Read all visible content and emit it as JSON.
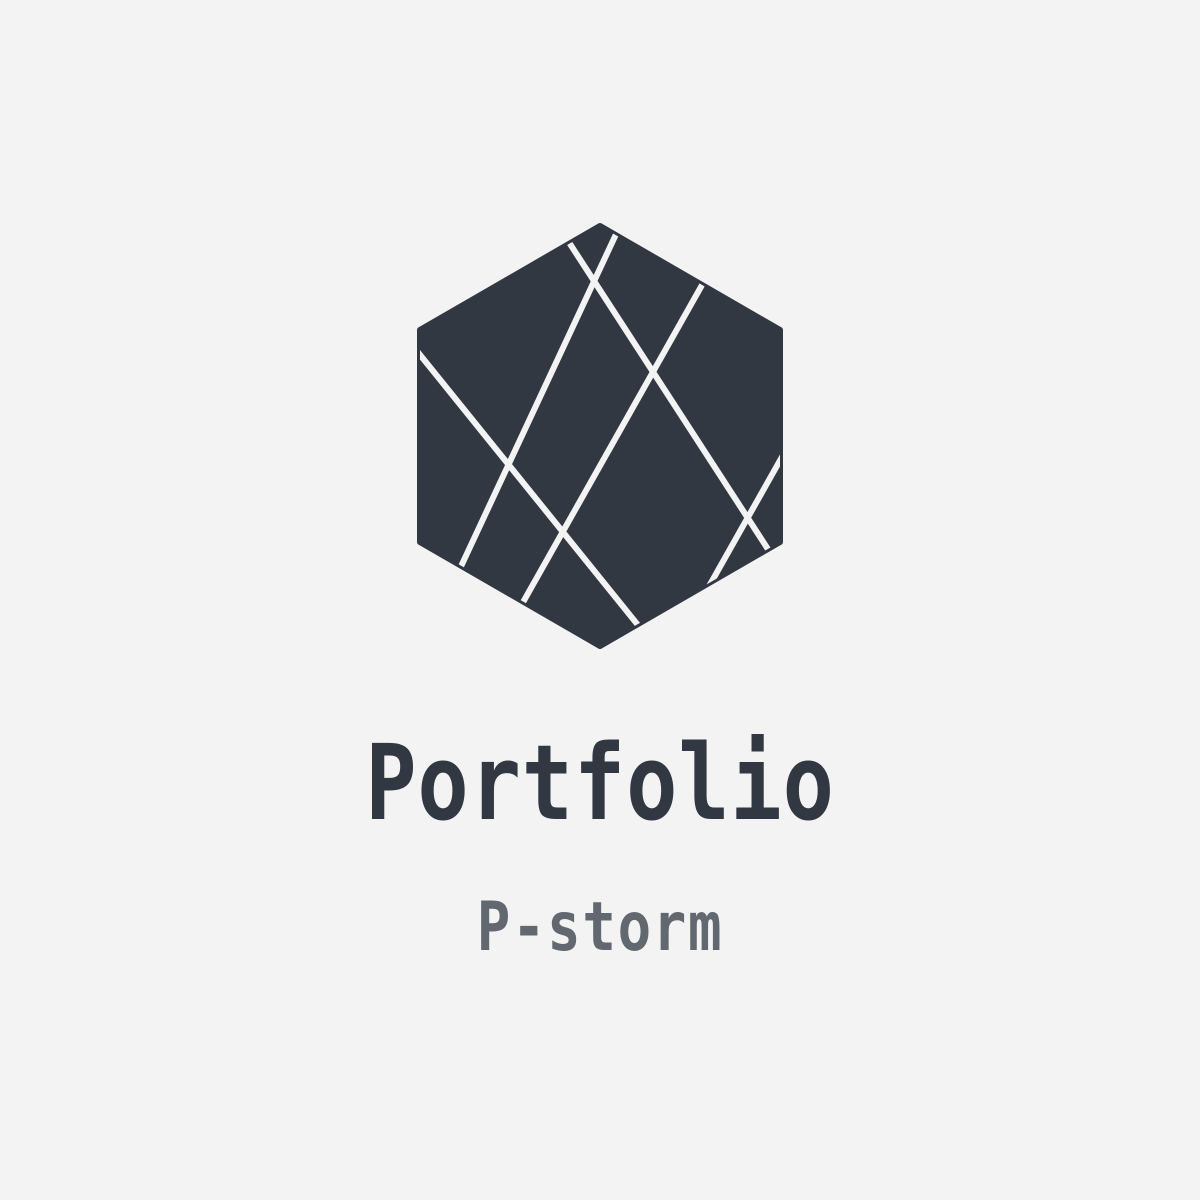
{
  "colors": {
    "background": "#f3f3f3",
    "mark": "#313842",
    "title": "#313842",
    "subtitle": "#626870",
    "facet_line": "#f3f3f3"
  },
  "logo": {
    "icon": "faceted-hexagon-icon"
  },
  "text": {
    "title": "Portfolio",
    "subtitle": "P-storm"
  }
}
